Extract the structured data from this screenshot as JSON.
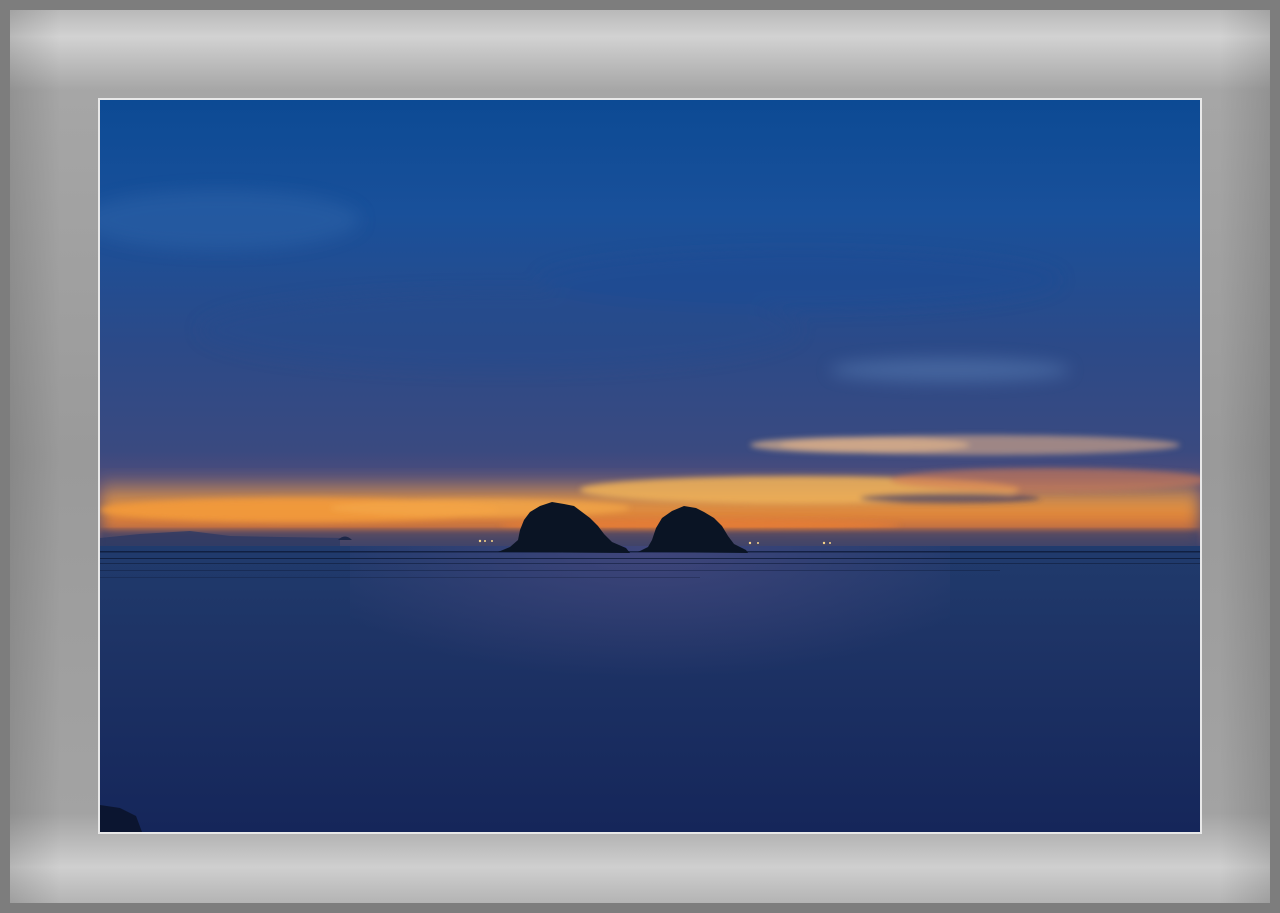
{
  "image": {
    "subject": "twilight-seascape-with-two-islands",
    "colors": {
      "sky_top": "#0c4d9a",
      "sky_mid": "#274a86",
      "sky_low": "#3d4a7e",
      "glow_orange": "#f08a2c",
      "glow_yellow": "#f3b04f",
      "sea_top": "#1b3566",
      "sea_bottom": "#16275a",
      "island": "#0a1424",
      "mat": "#a0a0a0",
      "frame_border": "#7d7d7d"
    }
  }
}
